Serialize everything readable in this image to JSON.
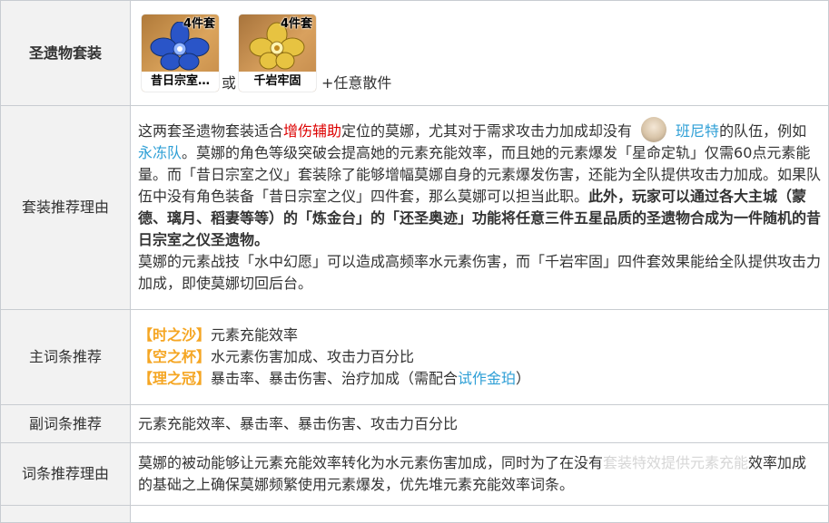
{
  "rows": {
    "artifact_set": {
      "label": "圣遗物套装",
      "items": [
        {
          "badge": "4件套",
          "name": "昔日宗室…",
          "icon": "blue-flower-icon"
        },
        {
          "badge": "4件套",
          "name": "千岩牢固",
          "icon": "gold-flower-icon"
        }
      ],
      "or_text": "或",
      "tail_text": "+任意散件"
    },
    "reason": {
      "label": "套装推荐理由",
      "p1_a": "这两套圣遗物套装适合",
      "p1_red": "增伤辅助",
      "p1_b": "定位的莫娜，尤其对于需求攻击力加成却没有",
      "p1_link": "班尼特",
      "p1_c": "的队伍，例如",
      "p1_link2": "永冻队",
      "p1_d": "。莫娜的角色等级突破会提高她的元素充能效率，而且她的元素爆发「星命定轨」仅需60点元素能量。而「昔日宗室之仪」套装除了能够增幅莫娜自身的元素爆发伤害，还能为全队提供攻击力加成。如果队伍中没有角色装备「昔日宗室之仪」四件套，那么莫娜可以担当此职。",
      "p1_bold": "此外，玩家可以通过各大主城（蒙德、璃月、稻妻等等）的「炼金台」的「还圣奥迹」功能将任意三件五星品质的圣遗物合成为一件随机的昔日宗室之仪圣遗物。",
      "p2": "莫娜的元素战技「水中幻愿」可以造成高频率水元素伤害，而「千岩牢固」四件套效果能给全队提供攻击力加成，即使莫娜切回后台。"
    },
    "main_stats": {
      "label": "主词条推荐",
      "lines": [
        {
          "tag": "【时之沙】",
          "text": "元素充能效率"
        },
        {
          "tag": "【空之杯】",
          "text": "水元素伤害加成、攻击力百分比"
        },
        {
          "tag": "【理之冠】",
          "text": "暴击率、暴击伤害、治疗加成（需配合",
          "link": "试作金珀",
          "after": "）"
        }
      ]
    },
    "sub_stats": {
      "label": "副词条推荐",
      "text": "元素充能效率、暴击率、暴击伤害、攻击力百分比"
    },
    "stat_reason": {
      "label": "词条推荐理由",
      "text_a": "莫娜的被动能够让元素充能效率转化为水元素伤害加成，同时为了在没有",
      "text_wm": "套装特效提供元素充能",
      "text_b": "效率加成的基础之上确保莫娜频繁使用元素爆发，优先堆元素充能效率词条。"
    }
  },
  "colors": {
    "highlight_red": "#dd0000",
    "link_blue": "#2e9fd6",
    "tag_orange": "#f5a623",
    "label_bg": "#f2f2f2",
    "border": "#c8ccd1"
  }
}
